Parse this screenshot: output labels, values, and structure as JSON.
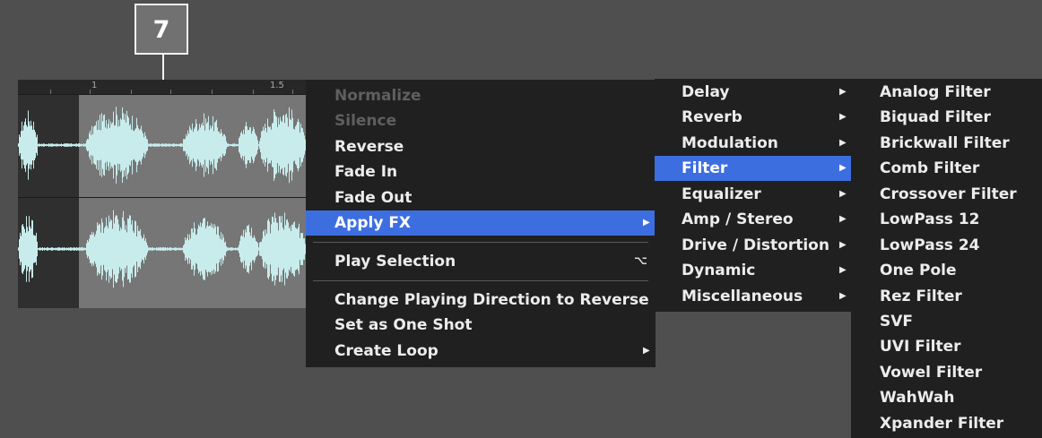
{
  "callout": {
    "number": "7"
  },
  "waveform": {
    "ruler_labels": [
      "1",
      "1.5"
    ]
  },
  "context_menu": {
    "items": [
      {
        "label": "Normalize",
        "enabled": false
      },
      {
        "label": "Silence",
        "enabled": false
      },
      {
        "label": "Reverse",
        "enabled": true
      },
      {
        "label": "Fade In",
        "enabled": true
      },
      {
        "label": "Fade Out",
        "enabled": true
      },
      {
        "label": "Apply FX",
        "enabled": true,
        "highlighted": true,
        "submenu": true
      },
      {
        "label": "Play Selection",
        "shortcut": "⌥"
      },
      {
        "label": "Change Playing Direction to Reverse"
      },
      {
        "label": "Set as One Shot"
      },
      {
        "label": "Create Loop",
        "submenu": true
      }
    ]
  },
  "fx_menu": {
    "items": [
      "Delay",
      "Reverb",
      "Modulation",
      "Filter",
      "Equalizer",
      "Amp / Stereo",
      "Drive / Distortion",
      "Dynamic",
      "Miscellaneous"
    ],
    "highlighted": "Filter"
  },
  "filter_menu": {
    "items": [
      "Analog Filter",
      "Biquad Filter",
      "Brickwall Filter",
      "Comb Filter",
      "Crossover Filter",
      "LowPass 12",
      "LowPass 24",
      "One Pole",
      "Rez Filter",
      "SVF",
      "UVI Filter",
      "Vowel Filter",
      "WahWah",
      "Xpander Filter"
    ]
  },
  "colors": {
    "highlight": "#3d6ee0",
    "waveform": "#c8ecec",
    "menu_bg": "#202020",
    "background": "#4f4f4f"
  },
  "icons": {
    "submenu_arrow": "▶"
  }
}
